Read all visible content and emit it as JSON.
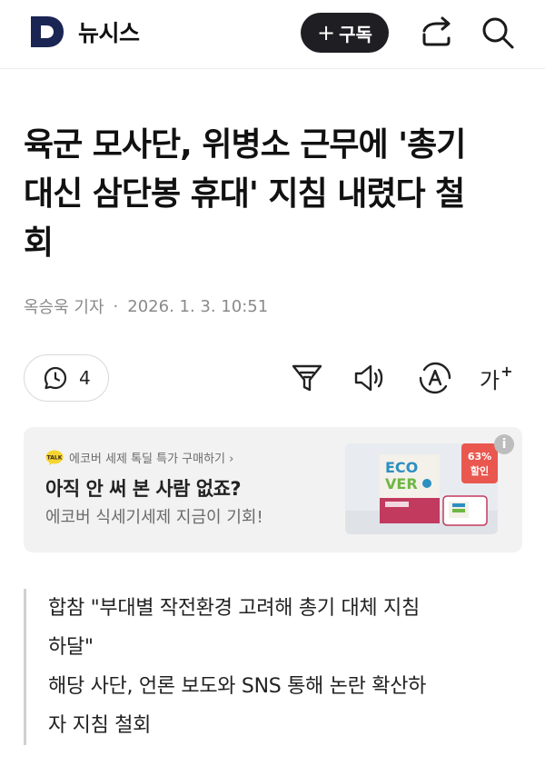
{
  "header": {
    "brand": "뉴시스",
    "subscribe_label": "구독",
    "subscribe_icon": "plus"
  },
  "article": {
    "title_lines": [
      "육군 모사단, 위병소 근무에 '총기",
      "대신 삼단봉 휴대' 지침 내렸다 철",
      "회"
    ],
    "byline_author": "옥승욱 기자",
    "byline_date": "2026. 1. 3. 10:51"
  },
  "toolbar": {
    "comment_count": "4",
    "font_size_label": "가",
    "font_size_plus": "+"
  },
  "ad": {
    "brand_line": "에코버 세제 톡딜 특가 구매하기 ›",
    "talk_badge": "TALK",
    "headline": "아직 안 써 본 사람 없죠?",
    "description": "에코버 식세기세제 지금이 기회!",
    "discount_percent": "63%",
    "discount_label": "할인",
    "product_brand_top": "ECO",
    "product_brand_bottom": "VER",
    "info_label": "i"
  },
  "summary": {
    "lines": [
      "합참 \"부대별 작전환경 고려해 총기 대체 지침",
      "하달\"",
      "해당 사단, 언론 보도와 SNS 통해 논란 확산하",
      "자 지침 철회"
    ]
  },
  "colors": {
    "brand_navy": "#1b2553",
    "subscribe_bg": "#1f1f23",
    "ad_bg": "#f2f2f2",
    "discount_red": "#e9574f"
  }
}
